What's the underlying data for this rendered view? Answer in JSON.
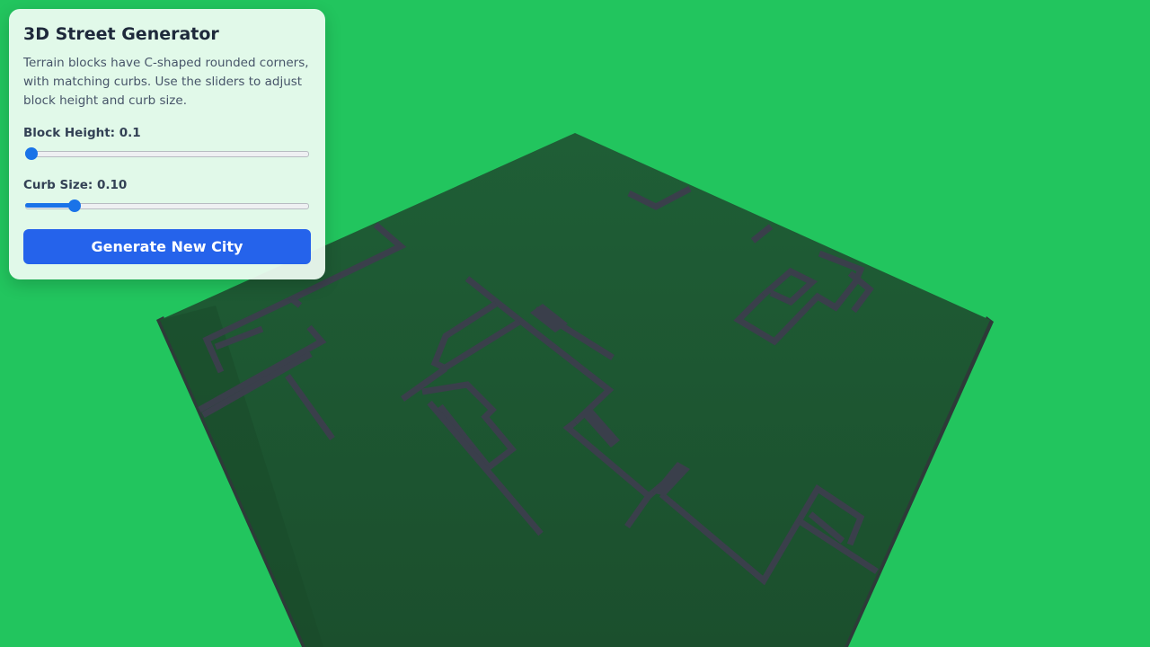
{
  "panel": {
    "title": "3D Street Generator",
    "description": "Terrain blocks have C-shaped rounded corners, with matching curbs. Use the sliders to adjust block height and curb size.",
    "block_height": {
      "label_text": "Block Height: 0.1",
      "value_fraction": 0.0
    },
    "curb_size": {
      "label_text": "Curb Size: 0.10",
      "value_fraction": 0.16
    },
    "generate_button": "Generate New City"
  },
  "colors": {
    "sky": "#22c55e",
    "terrain": "#1e5631",
    "street": "#374151",
    "accent": "#2563eb",
    "slider": "#1a73e8"
  }
}
